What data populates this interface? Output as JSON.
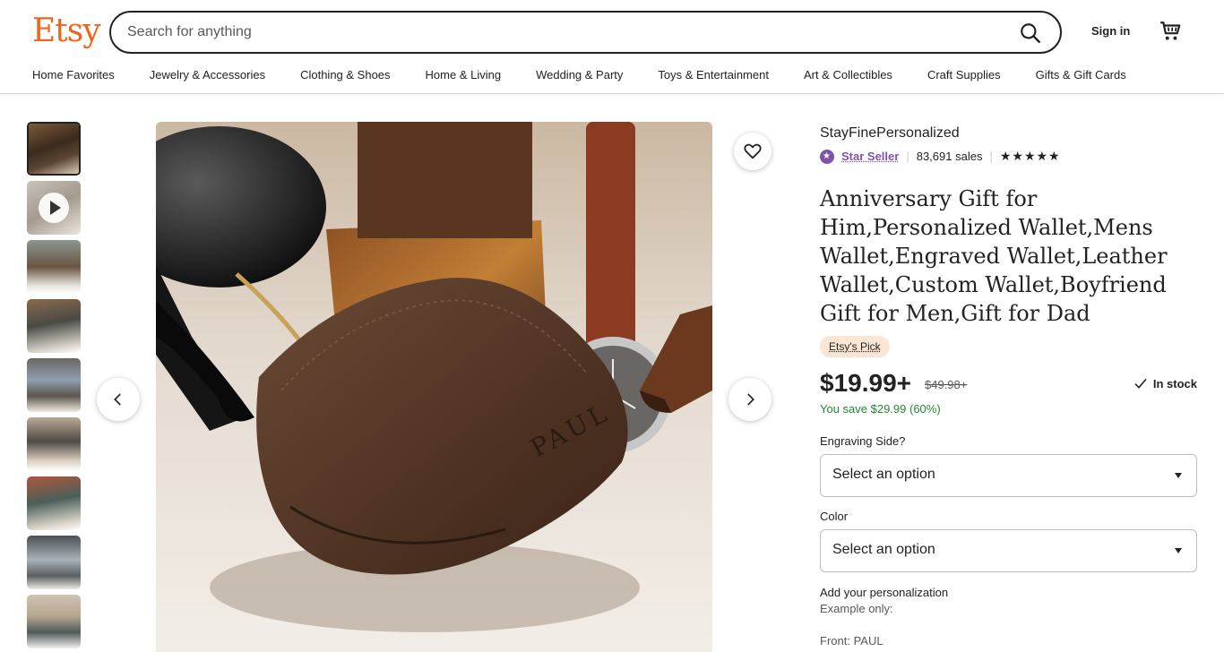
{
  "header": {
    "logo": "Etsy",
    "search_placeholder": "Search for anything",
    "sign_in": "Sign in",
    "nav": [
      "Home Favorites",
      "Jewelry & Accessories",
      "Clothing & Shoes",
      "Home & Living",
      "Wedding & Party",
      "Toys & Entertainment",
      "Art & Collectibles",
      "Craft Supplies",
      "Gifts & Gift Cards"
    ]
  },
  "icons": {
    "search": "search-icon",
    "cart": "cart-icon",
    "favorite": "heart-icon",
    "prev": "chevron-left-icon",
    "next": "chevron-right-icon",
    "play": "play-icon",
    "stock": "checkmark-icon",
    "star_seller": "star-badge-icon"
  },
  "colors": {
    "brand": "#f1641e",
    "star_seller": "#7f53ac",
    "savings": "#258635",
    "pick_badge": "#fbe6d5"
  },
  "listing": {
    "shop_name": "StayFinePersonalized",
    "star_seller": "Star Seller",
    "sales": "83,691 sales",
    "rating": "★★★★★",
    "title": "Anniversary Gift for Him,Personalized Wallet,Mens Wallet,Engraved Wallet,Leather Wallet,Custom Wallet,Boyfriend Gift for Men,Gift for Dad",
    "badge": "Etsy's Pick",
    "price": "$19.99+",
    "original_price": "$49.98+",
    "stock": "In stock",
    "savings": "You save $29.99 (60%)",
    "options": [
      {
        "label": "Engraving Side?",
        "value": "Select an option"
      },
      {
        "label": "Color",
        "value": "Select an option"
      }
    ],
    "personalization_label": "Add your personalization",
    "example_label": "Example only:",
    "example_front": "Front: PAUL"
  },
  "main_image": {
    "engraving": "PAUL"
  }
}
